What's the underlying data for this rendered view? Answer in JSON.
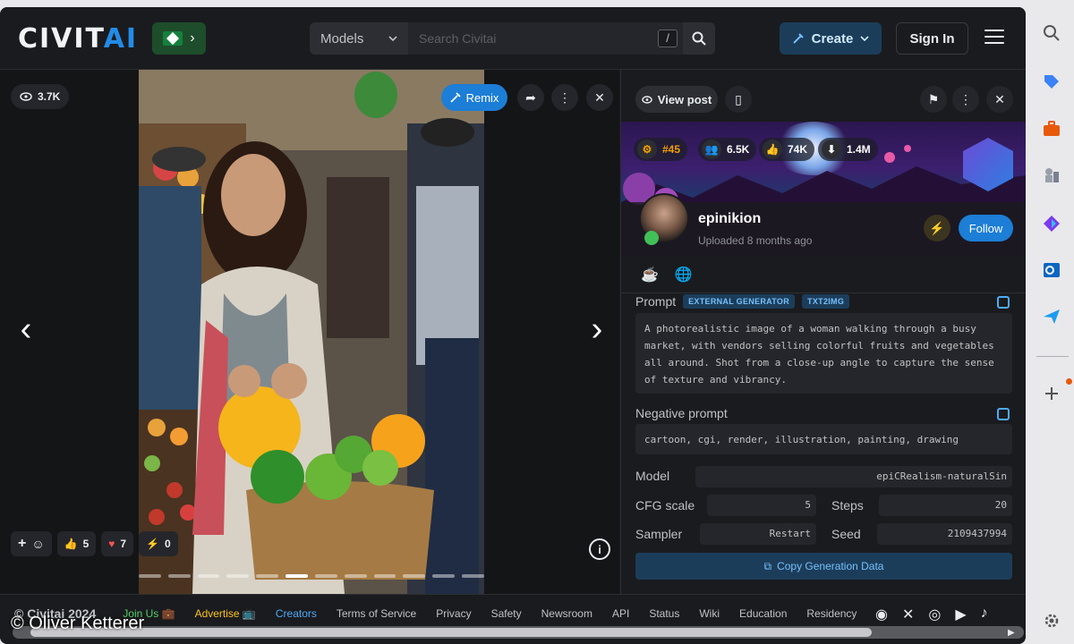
{
  "header": {
    "logo_main": "CIVIT",
    "logo_accent": "AI",
    "search_category": "Models",
    "search_placeholder": "Search Civitai",
    "search_shortcut": "/",
    "create_label": "Create",
    "signin_label": "Sign In"
  },
  "viewer": {
    "views": "3.7K",
    "remix_label": "Remix",
    "reactions": [
      {
        "icon": "thumbs-up",
        "count": "5"
      },
      {
        "icon": "heart",
        "count": "7"
      },
      {
        "icon": "lightning",
        "count": "0"
      }
    ],
    "slide_count": 12,
    "active_slide": 6
  },
  "panel": {
    "view_post_label": "View post",
    "rank": "#45",
    "followers": "6.5K",
    "likes": "74K",
    "downloads": "1.4M",
    "username": "epinikion",
    "uploaded": "Uploaded 8 months ago",
    "follow_label": "Follow",
    "prompt_label": "Prompt",
    "tag_generator": "EXTERNAL GENERATOR",
    "tag_mode": "TXT2IMG",
    "prompt_text": "A photorealistic image of a woman walking through a busy market, with vendors selling colorful fruits and vegetables all around. Shot from a close-up angle to capture the sense of texture and vibrancy.",
    "negative_label": "Negative prompt",
    "negative_text": "cartoon, cgi, render, illustration, painting, drawing",
    "model_label": "Model",
    "model_value": "epiCRealism-naturalSin",
    "cfg_label": "CFG scale",
    "cfg_value": "5",
    "steps_label": "Steps",
    "steps_value": "20",
    "sampler_label": "Sampler",
    "sampler_value": "Restart",
    "seed_label": "Seed",
    "seed_value": "2109437994",
    "copy_gen_label": "Copy Generation Data"
  },
  "footer": {
    "copyright": "© Civitai 2024",
    "links": [
      "Join Us 💼",
      "Advertise 📺",
      "Creators",
      "Terms of Service",
      "Privacy",
      "Safety",
      "Newsroom",
      "API",
      "Status",
      "Wiki",
      "Education",
      "Residency"
    ]
  },
  "watermark": "© Oliver Ketterer",
  "colors": {
    "background": "#1a1b1e",
    "accent": "#228be6",
    "follow": "#1c7ed6",
    "join_us": "#51cf66",
    "advertise": "#fcc419"
  }
}
